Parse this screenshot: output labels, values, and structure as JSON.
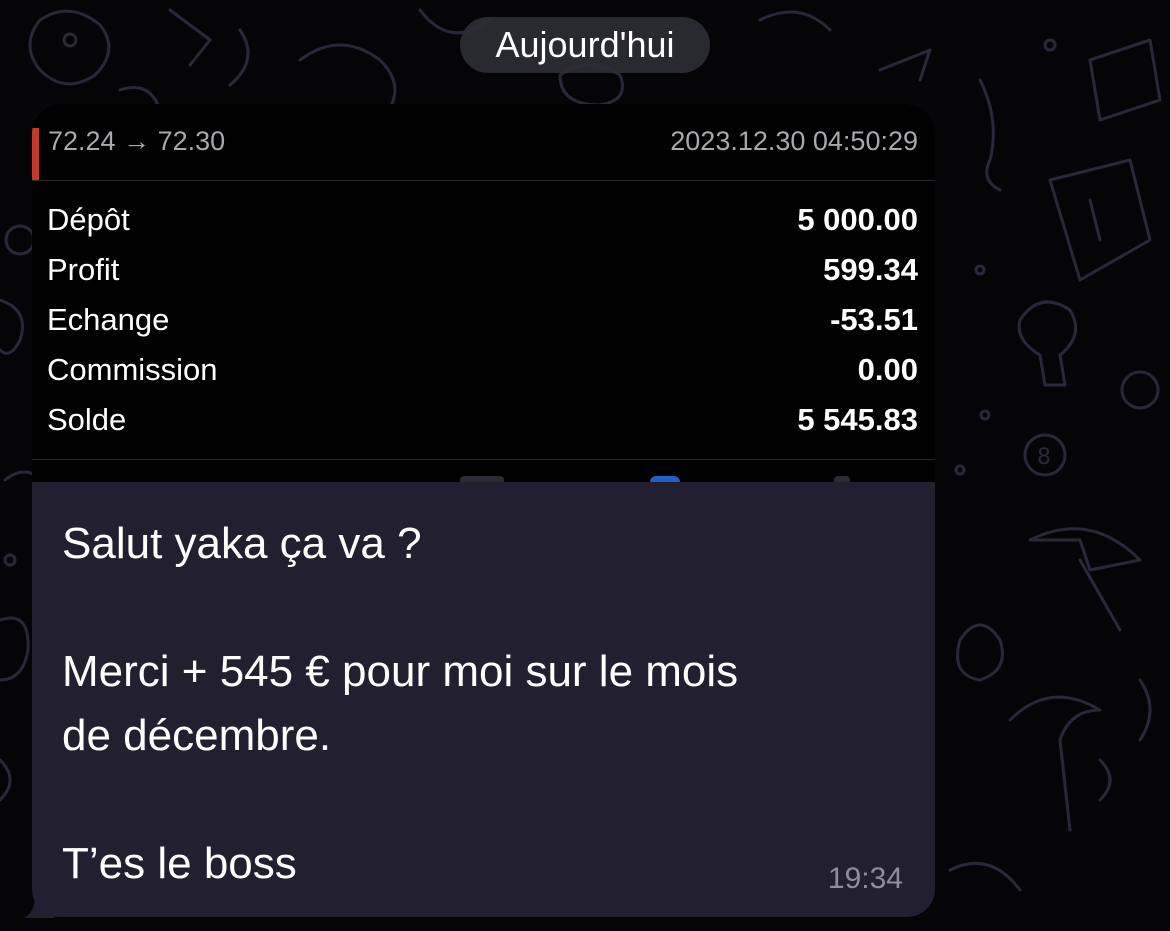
{
  "date_separator": "Aujourd'hui",
  "trade_card": {
    "price_range": "72.24 → 72.30",
    "datetime": "2023.12.30 04:50:29",
    "rows": [
      {
        "label": "Dépôt",
        "value": "5 000.00"
      },
      {
        "label": "Profit",
        "value": "599.34"
      },
      {
        "label": "Echange",
        "value": "-53.51"
      },
      {
        "label": "Commission",
        "value": "0.00"
      },
      {
        "label": "Solde",
        "value": "5 545.83"
      }
    ]
  },
  "message": {
    "line1": "Salut yaka ça va ?",
    "line2": "Merci + 545 € pour moi sur le mois",
    "line3": "de décembre.",
    "line4": "T’es le boss",
    "time": "19:34"
  },
  "colors": {
    "background": "#050508",
    "bubble": "#222030",
    "accent_red": "#c0392b",
    "doodle": "#2a2838"
  }
}
